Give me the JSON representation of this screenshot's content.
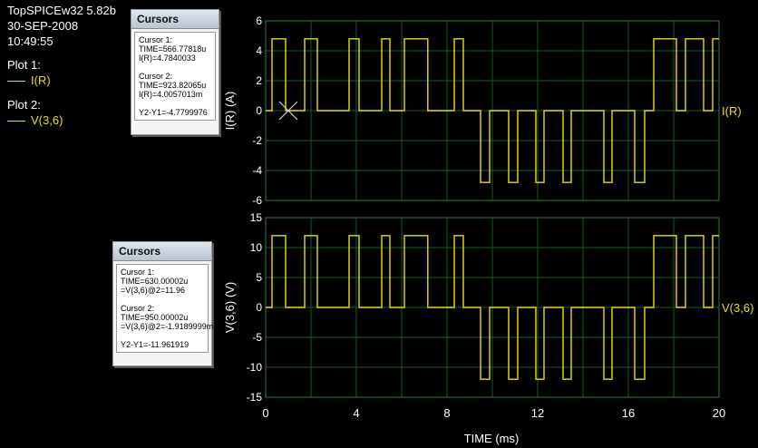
{
  "header": {
    "app": "TopSPICEw32 5.82b",
    "date": "30-SEP-2008",
    "time": "10:49:55"
  },
  "plot_list": [
    {
      "label": "Plot 1:",
      "trace": "I(R)"
    },
    {
      "label": "Plot 2:",
      "trace": "V(3,6)"
    }
  ],
  "cursor_windows": [
    {
      "title": "Cursors",
      "c1_label": "Cursor 1:",
      "c1_time": "TIME=566.77818u",
      "c1_value": "I(R)=4.7840033",
      "c2_label": "Cursor 2:",
      "c2_time": "TIME=923.82065u",
      "c2_value": "I(R)=4.0057013m",
      "diff": "Y2-Y1=-4.7799976"
    },
    {
      "title": "Cursors",
      "c1_label": "Cursor 1:",
      "c1_time": "TIME=630.00002u",
      "c1_value": "=V(3,6)@2=11.96",
      "c2_label": "Cursor 2:",
      "c2_time": "TIME=950.00002u",
      "c2_value": "=V(3,6)@2=-1.9189999m",
      "diff": "Y2-Y1=-11.961919"
    }
  ],
  "colors": {
    "background": "#000000",
    "grid": "#1c5a1c",
    "trace": "#e8e000",
    "text": "#ffffff"
  },
  "chart_data": [
    {
      "type": "line",
      "ylabel": "I(R)  (A)",
      "xlabel": "",
      "series_label": "I(R)",
      "xlim": [
        0,
        20
      ],
      "ylim": [
        -6,
        6
      ],
      "yticks": [
        6,
        4,
        2,
        0,
        -2,
        -4,
        -6
      ],
      "x": [
        0,
        0.28,
        0.28,
        0.88,
        0.88,
        1.72,
        1.72,
        2.28,
        2.28,
        3.68,
        3.68,
        4.12,
        4.12,
        5.12,
        5.12,
        5.48,
        5.48,
        6.12,
        6.12,
        7.15,
        7.15,
        8.32,
        8.32,
        8.72,
        8.72,
        9.48,
        9.48,
        9.88,
        9.88,
        10.72,
        10.72,
        11.12,
        11.12,
        11.92,
        11.92,
        12.28,
        12.28,
        13.12,
        13.12,
        13.48,
        13.48,
        14.92,
        14.92,
        15.28,
        15.28,
        16.28,
        16.28,
        16.72,
        16.72,
        17.12,
        17.12,
        18.12,
        18.12,
        18.52,
        18.52,
        19.32,
        19.32,
        19.72,
        19.72,
        20
      ],
      "y": [
        0,
        0,
        4.8,
        4.8,
        0,
        0,
        4.8,
        4.8,
        0,
        0,
        4.8,
        4.8,
        0,
        0,
        4.8,
        4.8,
        0,
        0,
        4.8,
        4.8,
        0,
        0,
        4.8,
        4.8,
        0,
        0,
        -4.8,
        -4.8,
        0,
        0,
        -4.8,
        -4.8,
        0,
        0,
        -4.8,
        -4.8,
        0,
        0,
        -4.8,
        -4.8,
        0,
        0,
        -4.8,
        -4.8,
        0,
        0,
        -4.8,
        -4.8,
        0,
        0,
        4.8,
        4.8,
        0,
        0,
        4.8,
        4.8,
        0,
        0,
        4.8,
        4.8
      ]
    },
    {
      "type": "line",
      "ylabel": "V(3,6)  (V)",
      "xlabel": "TIME  (ms)",
      "series_label": "V(3,6)",
      "xlim": [
        0,
        20
      ],
      "ylim": [
        -15,
        15
      ],
      "xticks": [
        0,
        4,
        8,
        12,
        16,
        20
      ],
      "yticks": [
        15,
        10,
        5,
        0,
        -5,
        -10,
        -15
      ],
      "x": [
        0,
        0.28,
        0.28,
        0.88,
        0.88,
        1.72,
        1.72,
        2.28,
        2.28,
        3.68,
        3.68,
        4.12,
        4.12,
        5.12,
        5.12,
        5.48,
        5.48,
        6.12,
        6.12,
        7.15,
        7.15,
        8.32,
        8.32,
        8.72,
        8.72,
        9.48,
        9.48,
        9.88,
        9.88,
        10.72,
        10.72,
        11.12,
        11.12,
        11.92,
        11.92,
        12.28,
        12.28,
        13.12,
        13.12,
        13.48,
        13.48,
        14.92,
        14.92,
        15.28,
        15.28,
        16.28,
        16.28,
        16.72,
        16.72,
        17.12,
        17.12,
        18.12,
        18.12,
        18.52,
        18.52,
        19.32,
        19.32,
        19.72,
        19.72,
        20
      ],
      "y": [
        0,
        0,
        12,
        12,
        0,
        0,
        12,
        12,
        0,
        0,
        12,
        12,
        0,
        0,
        12,
        12,
        0,
        0,
        12,
        12,
        0,
        0,
        12,
        12,
        0,
        0,
        -12,
        -12,
        0,
        0,
        -12,
        -12,
        0,
        0,
        -12,
        -12,
        0,
        0,
        -12,
        -12,
        0,
        0,
        -12,
        -12,
        0,
        0,
        -12,
        -12,
        0,
        0,
        12,
        12,
        0,
        0,
        12,
        12,
        0,
        0,
        12,
        12
      ]
    }
  ]
}
